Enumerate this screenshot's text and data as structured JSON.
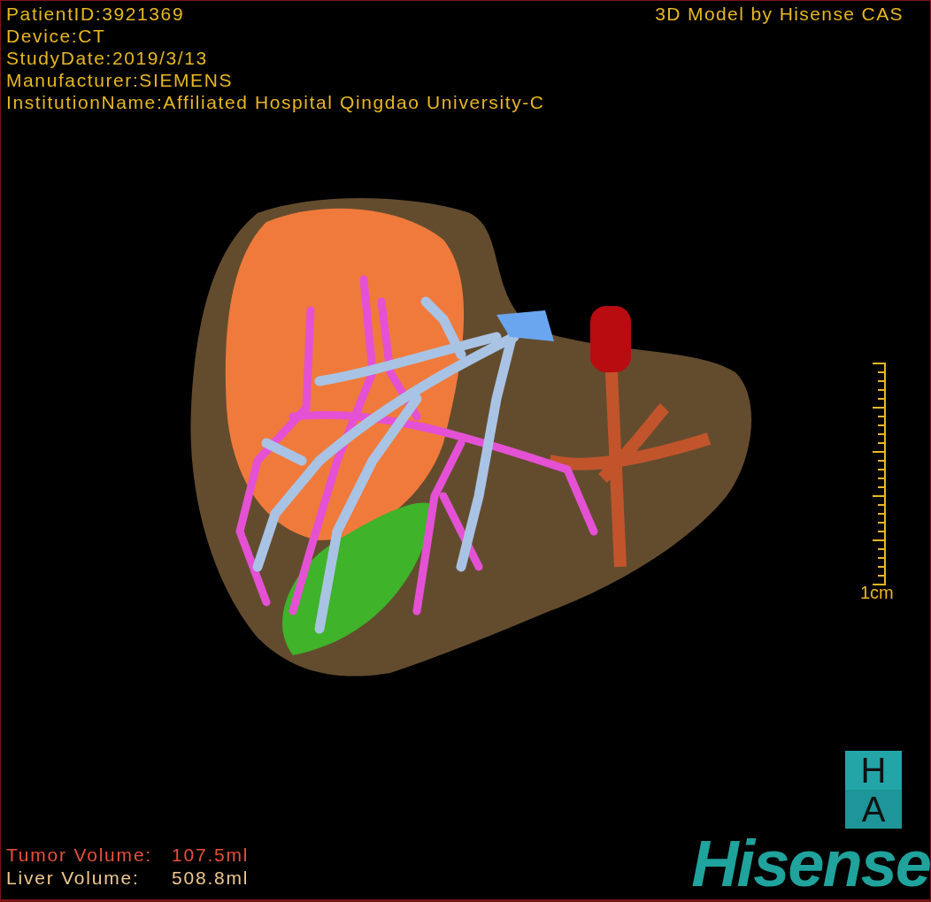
{
  "info_lines": [
    "PatientID:3921369",
    "Device:CT",
    "StudyDate:2019/3/13",
    "Manufacturer:SIEMENS",
    "InstitutionName:Affiliated Hospital Qingdao University-C"
  ],
  "title": "3D Model by Hisense CAS",
  "scale_bar": {
    "label": "1cm"
  },
  "volumes": [
    {
      "kind": "tumor",
      "label": "Tumor Volume:",
      "value": "107.5ml"
    },
    {
      "kind": "liver",
      "label": "Liver Volume:",
      "value": "508.8ml"
    }
  ],
  "logo": {
    "tiles": [
      "H",
      "A"
    ],
    "wordmark": "Hisense"
  }
}
